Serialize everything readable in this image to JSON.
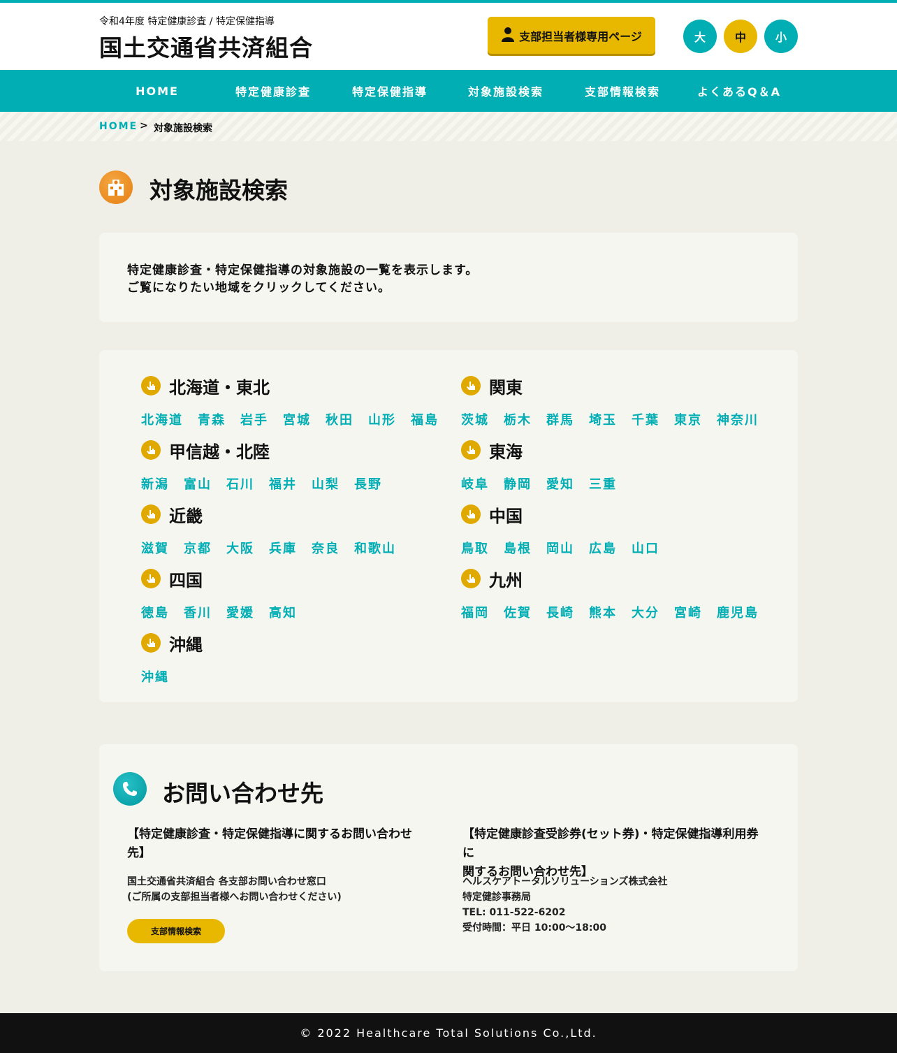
{
  "header": {
    "subtitle": "令和4年度 特定健康診査 / 特定保健指導",
    "title": "国土交通省共済組合",
    "staff_button": "支部担当者様専用ページ",
    "font_size_buttons": [
      "大",
      "中",
      "小"
    ]
  },
  "nav": {
    "items": [
      "HOME",
      "特定健康診査",
      "特定保健指導",
      "対象施設検索",
      "支部情報検索",
      "よくあるQ＆A"
    ]
  },
  "breadcrumb": {
    "home": "HOME",
    "separator": ">",
    "current": "対象施設検索"
  },
  "page": {
    "title": "対象施設検索",
    "icon": "hospital-icon",
    "intro_lines": [
      "特定健康診査・特定保健指導の対象施設の一覧を表示します。",
      "ご覧になりたい地域をクリックしてください。"
    ]
  },
  "regions": [
    {
      "name": "北海道・東北",
      "prefectures": [
        "北海道",
        "青森",
        "岩手",
        "宮城",
        "秋田",
        "山形",
        "福島"
      ]
    },
    {
      "name": "関東",
      "prefectures": [
        "茨城",
        "栃木",
        "群馬",
        "埼玉",
        "千葉",
        "東京",
        "神奈川"
      ]
    },
    {
      "name": "甲信越・北陸",
      "prefectures": [
        "新潟",
        "富山",
        "石川",
        "福井",
        "山梨",
        "長野"
      ]
    },
    {
      "name": "東海",
      "prefectures": [
        "岐阜",
        "静岡",
        "愛知",
        "三重"
      ]
    },
    {
      "name": "近畿",
      "prefectures": [
        "滋賀",
        "京都",
        "大阪",
        "兵庫",
        "奈良",
        "和歌山"
      ]
    },
    {
      "name": "中国",
      "prefectures": [
        "鳥取",
        "島根",
        "岡山",
        "広島",
        "山口"
      ]
    },
    {
      "name": "四国",
      "prefectures": [
        "徳島",
        "香川",
        "愛媛",
        "高知"
      ]
    },
    {
      "name": "九州",
      "prefectures": [
        "福岡",
        "佐賀",
        "長崎",
        "熊本",
        "大分",
        "宮崎",
        "鹿児島"
      ]
    },
    {
      "name": "沖縄",
      "prefectures": [
        "沖縄"
      ]
    }
  ],
  "contact": {
    "title": "お問い合わせ先",
    "left": {
      "heading_lines": [
        "【特定健康診査・特定保健指導に関するお問い合わせ",
        "先】"
      ],
      "text_lines": [
        "国土交通省共済組合 各支部お問い合わせ窓口",
        "(ご所属の支部担当者様へお問い合わせください)"
      ],
      "button": "支部情報検索"
    },
    "right": {
      "heading_lines": [
        "【特定健康診査受診券(セット券)・特定保健指導利用券に",
        "関するお問い合わせ先】"
      ],
      "text_lines": [
        "ヘルスケアトータルソリューションズ株式会社",
        "特定健診事務局",
        "TEL: 011-522-6202",
        "受付時間：平日 10:00～18:00"
      ]
    }
  },
  "footer": {
    "copyright": "© 2022 Healthcare Total Solutions Co.,Ltd."
  },
  "colors": {
    "accent": "#00aeb4",
    "yellow": "#e8b800",
    "orange": "#e57f14",
    "background": "#efefe7",
    "footer": "#111111"
  }
}
